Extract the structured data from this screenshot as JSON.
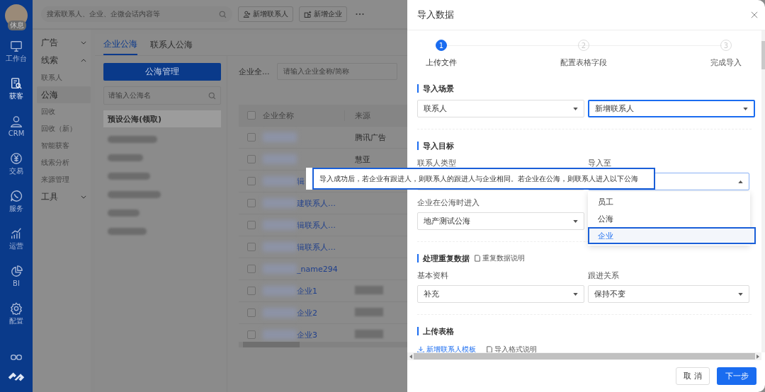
{
  "rail": {
    "avatar_badge": "休息",
    "items": [
      {
        "label": "工作台",
        "selected": false
      },
      {
        "label": "获客",
        "selected": true
      },
      {
        "label": "CRM",
        "selected": false
      },
      {
        "label": "交易",
        "selected": false
      },
      {
        "label": "服务",
        "selected": false
      },
      {
        "label": "运营",
        "selected": false
      },
      {
        "label": "BI",
        "selected": false
      },
      {
        "label": "配置",
        "selected": false
      }
    ]
  },
  "search": {
    "placeholder": "搜索联系人、企业、企微会话内容等"
  },
  "top_buttons": [
    "新增联系人",
    "新增企业"
  ],
  "menu": [
    {
      "label": "广告",
      "expanded": false
    },
    {
      "label": "线索",
      "expanded": true,
      "children": [
        {
          "label": "联系人",
          "selected": false
        },
        {
          "label": "公海",
          "selected": true
        },
        {
          "label": "回收",
          "selected": false
        },
        {
          "label": "回收（新）",
          "selected": false
        },
        {
          "label": "智能获客",
          "selected": false
        },
        {
          "label": "线索分析",
          "selected": false
        },
        {
          "label": "来源管理",
          "selected": false
        }
      ]
    },
    {
      "label": "工具",
      "expanded": false
    }
  ],
  "tabs": [
    {
      "label": "企业公海",
      "selected": true
    },
    {
      "label": "联系人公海",
      "selected": false
    }
  ],
  "pool_button": "公海管理",
  "pool_search": {
    "placeholder": "请输入公海名"
  },
  "pool_list": [
    {
      "label": "预设公海(领取)",
      "selected": true
    }
  ],
  "filter": {
    "label": "企业全...",
    "placeholder": "请输入企业全称/简称"
  },
  "table": {
    "columns": [
      "企业全称",
      "来源"
    ],
    "all_checked": false,
    "rows": [
      {
        "checked": false,
        "source": "腾讯广告"
      },
      {
        "checked": false,
        "source": "慧亚"
      },
      {
        "checked": false,
        "name": "辑"
      },
      {
        "checked": false,
        "name": "建联系人…"
      },
      {
        "checked": false,
        "name": "辑联系人…"
      },
      {
        "checked": false,
        "name": "辑联系人…"
      },
      {
        "checked": false,
        "name": "_name294"
      },
      {
        "checked": false,
        "name": "企业1",
        "source_redacted": true
      },
      {
        "checked": false,
        "name": "企业2",
        "source_redacted": true
      },
      {
        "checked": false,
        "name": "企业3",
        "source_redacted": true
      }
    ]
  },
  "drawer": {
    "title": "导入数据",
    "steps": [
      {
        "number": "1",
        "label": "上传文件",
        "selected": true
      },
      {
        "number": "2",
        "label": "配置表格字段",
        "selected": false
      },
      {
        "number": "3",
        "label": "完成导入",
        "selected": false
      }
    ],
    "scene": {
      "title": "导入场景",
      "fields": [
        {
          "value": "联系人",
          "focused": false
        },
        {
          "value": "新增联系人",
          "focused": true
        }
      ]
    },
    "target": {
      "title": "导入目标",
      "type_label": "联系人类型",
      "to_label": "导入至",
      "to_expanded": true,
      "pool_label": "企业在公海时进入",
      "pool_value": "地产测试公海"
    },
    "duplicates": {
      "title": "处理重复数据",
      "help_link": "重复数据说明",
      "fields": [
        {
          "label": "基本资料",
          "value": "补充"
        },
        {
          "label": "跟进关系",
          "value": "保持不变"
        }
      ]
    },
    "upload": {
      "title": "上传表格",
      "template_link": "新增联系人模板",
      "format_link": "导入格式说明"
    },
    "buttons": {
      "cancel": "取 消",
      "next": "下一步"
    }
  },
  "tooltip": "导入成功后，若企业有跟进人，则联系人的跟进人与企业相同。若企业在公海，则联系人进入以下公海",
  "dropdown": [
    {
      "label": "员工",
      "selected": false
    },
    {
      "label": "公海",
      "selected": false
    },
    {
      "label": "企业",
      "selected": true
    }
  ]
}
